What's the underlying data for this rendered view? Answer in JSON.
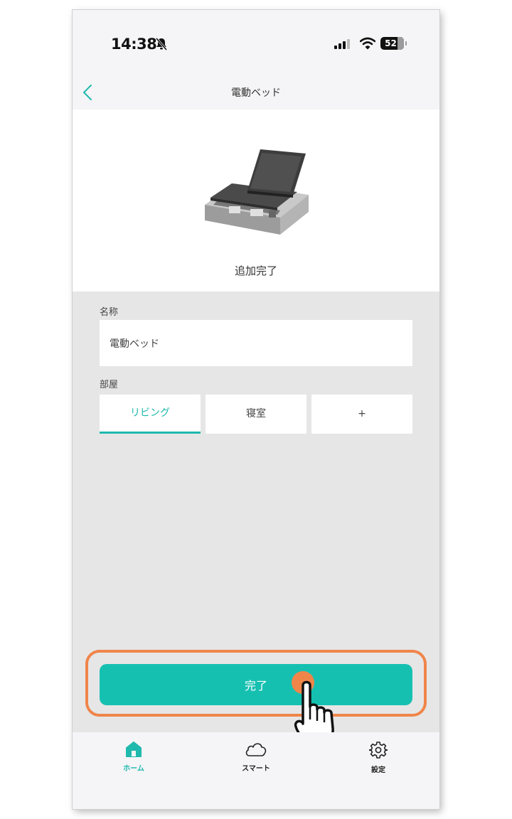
{
  "status_bar": {
    "time": "14:38",
    "battery": "52",
    "icons": [
      "bell-slash-icon",
      "cellular-signal-icon",
      "wifi-icon",
      "battery-icon"
    ]
  },
  "nav": {
    "title": "電動ベッド",
    "back_icon": "chevron-left-icon"
  },
  "device": {
    "image": "adjustable-bed",
    "status_text": "追加完了"
  },
  "form": {
    "name_label": "名称",
    "name_value": "電動ベッド",
    "room_label": "部屋",
    "rooms": [
      {
        "label": "リビング",
        "selected": true
      },
      {
        "label": "寝室",
        "selected": false
      },
      {
        "label": "+",
        "selected": false
      }
    ]
  },
  "done_button": {
    "label": "完了"
  },
  "tab_bar": {
    "items": [
      {
        "label": "ホーム",
        "icon": "home-icon",
        "active": true
      },
      {
        "label": "スマート",
        "icon": "cloud-icon",
        "active": false
      },
      {
        "label": "設定",
        "icon": "gear-icon",
        "active": false
      }
    ]
  },
  "colors": {
    "accent": "#1fb9ad",
    "button": "#16c0b1",
    "highlight": "#f0854a",
    "background": "#e6e6e6"
  }
}
